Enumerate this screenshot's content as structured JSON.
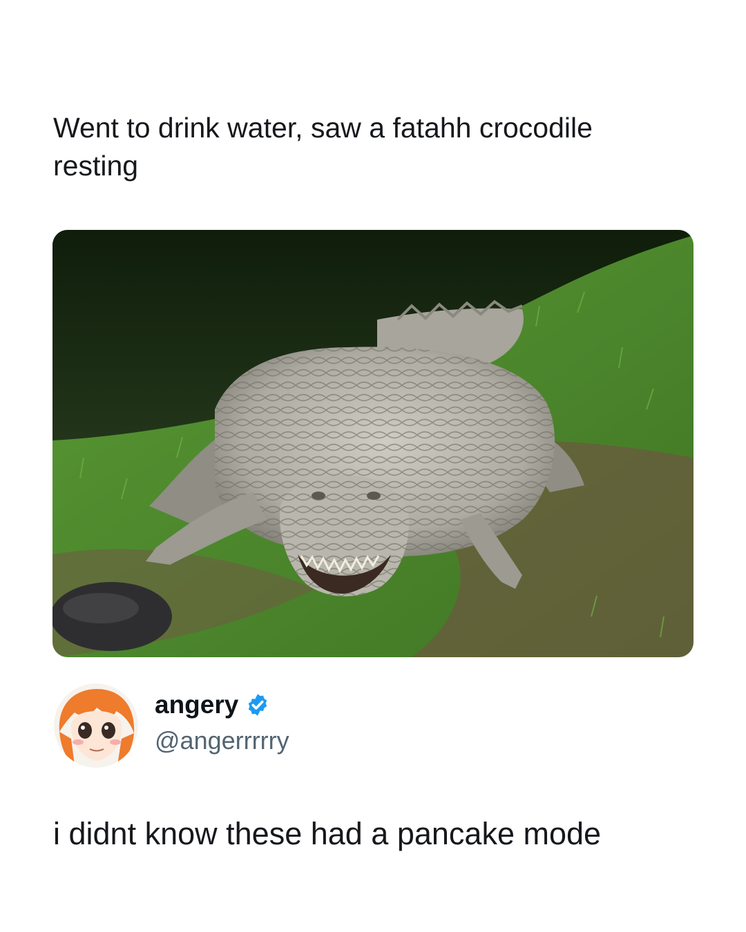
{
  "post": {
    "caption": "Went to drink water, saw a fatahh crocodile resting",
    "media_description": "crocodile lying flat on grass beside water",
    "author": {
      "display_name": "angery",
      "handle": "@angerrrrry",
      "verified": true,
      "verified_color": "#1d9bf0",
      "avatar_icon": "anime-girl-avatar-icon"
    },
    "reply_text": "i didnt know these had a pancake mode"
  },
  "colors": {
    "background": "#ffffff",
    "text": "#16181c",
    "handle": "#536471",
    "water": "#1a2a12",
    "grass": "#4d8a2e",
    "crocodile": "#b7b5aa"
  }
}
